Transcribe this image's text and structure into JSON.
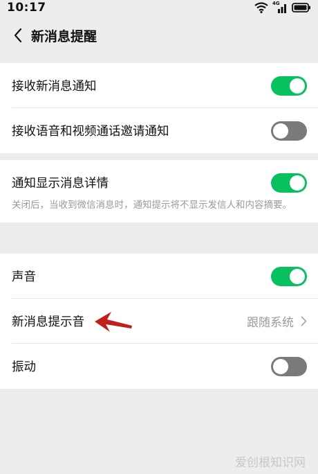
{
  "status_bar": {
    "time": "10:17",
    "network_label": "4G"
  },
  "header": {
    "title": "新消息提醒"
  },
  "section1": {
    "row1": {
      "label": "接收新消息通知",
      "enabled": true
    },
    "row2": {
      "label": "接收语音和视频通话邀请通知",
      "enabled": false
    }
  },
  "section2": {
    "row1": {
      "label": "通知显示消息详情",
      "enabled": true
    },
    "description": "关闭后，当收到微信消息时，通知提示将不显示发信人和内容摘要。"
  },
  "section3": {
    "sound": {
      "label": "声音",
      "enabled": true
    },
    "ringtone": {
      "label": "新消息提示音",
      "value": "跟随系统"
    },
    "vibrate": {
      "label": "振动",
      "enabled": false
    }
  },
  "watermark": "爱创根知识网",
  "colors": {
    "accent": "#07c160",
    "toggle_off": "#7a7a7a",
    "annotation_arrow": "#c0201b"
  }
}
